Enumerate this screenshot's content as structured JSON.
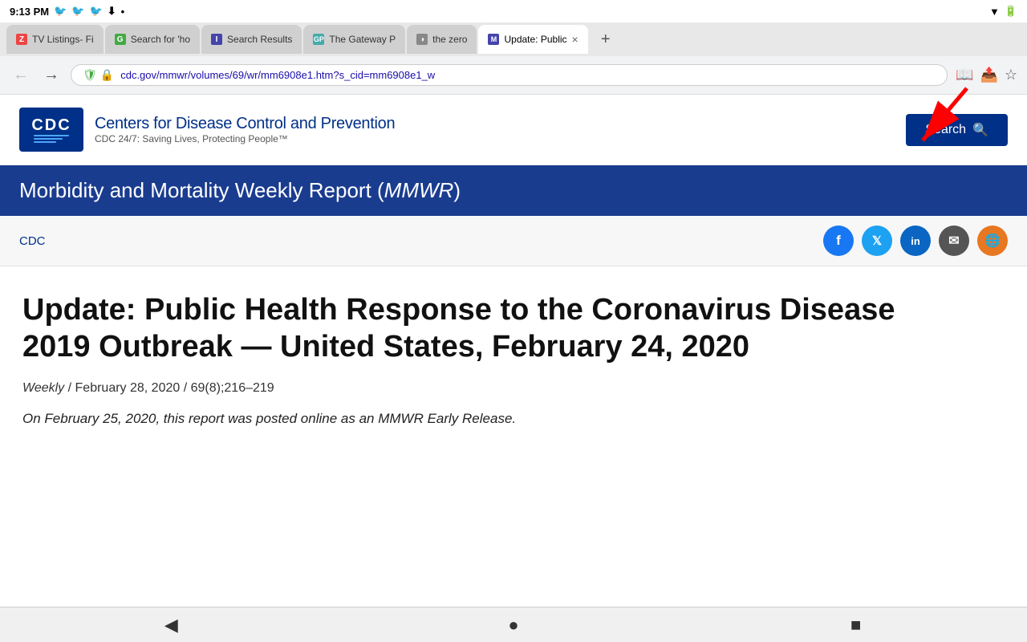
{
  "status_bar": {
    "time": "9:13 PM",
    "battery_icon": "🔋",
    "wifi_icon": "▼"
  },
  "tabs": [
    {
      "id": "tab1",
      "favicon_color": "#e44",
      "favicon_label": "Z",
      "label": "TV Listings- Fi",
      "active": false
    },
    {
      "id": "tab2",
      "favicon_color": "#4a4",
      "favicon_label": "G",
      "label": "Search for 'ho",
      "active": false
    },
    {
      "id": "tab3",
      "favicon_color": "#44a",
      "favicon_label": "I",
      "label": "Search Results",
      "active": false
    },
    {
      "id": "tab4",
      "favicon_color": "#4aa",
      "favicon_label": "GP",
      "label": "The Gateway P",
      "active": false
    },
    {
      "id": "tab5",
      "favicon_color": "#888",
      "favicon_label": "◑",
      "label": "the zero",
      "active": false
    },
    {
      "id": "tab6",
      "favicon_color": "#44a",
      "favicon_label": "M",
      "label": "Update: Public",
      "active": true
    }
  ],
  "address_bar": {
    "back_disabled": false,
    "forward_disabled": false,
    "url": "cdc.gov/mmwr/volumes/69/wr/mm6908e1.htm?s_cid=mm6908e1_w"
  },
  "cdc_header": {
    "logo_text": "CDC",
    "title": "Centers for Disease Control and Prevention",
    "subtitle": "CDC 24/7: Saving Lives, Protecting People™",
    "search_button": "Search"
  },
  "mmwr_banner": {
    "text_before": "Morbidity and Mortality Weekly Report (",
    "text_italic": "MMWR",
    "text_after": ")"
  },
  "breadcrumb": {
    "label": "CDC"
  },
  "social_icons": [
    {
      "name": "facebook",
      "color": "#1877f2",
      "label": "f"
    },
    {
      "name": "twitter",
      "color": "#1da1f2",
      "label": "t"
    },
    {
      "name": "linkedin",
      "color": "#0a66c2",
      "label": "in"
    },
    {
      "name": "email",
      "color": "#555",
      "label": "✉"
    },
    {
      "name": "globe",
      "color": "#e87722",
      "label": "🌐"
    }
  ],
  "article": {
    "title": "Update: Public Health Response to the Coronavirus Disease 2019 Outbreak — United States, February 24, 2020",
    "meta_journal": "Weekly",
    "meta_date": "February 28, 2020",
    "meta_volume": "69(8);216–219",
    "abstract_preview": "On February 25, 2020, this report was posted online as an MMWR Early Release."
  },
  "bottom_nav": {
    "back": "◀",
    "circle": "●",
    "square": "■"
  },
  "annotation": {
    "arrow_visible": true
  }
}
